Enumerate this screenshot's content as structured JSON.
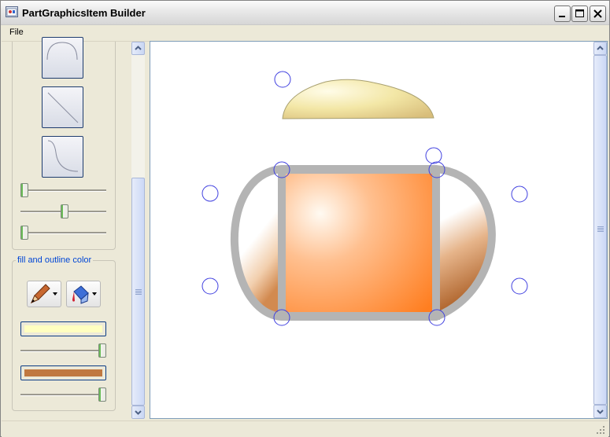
{
  "window": {
    "title": "PartGraphicsItem Builder"
  },
  "menu": {
    "file_label": "File"
  },
  "left_panel": {
    "group_fill_outline_label": "fill and outline color",
    "fill_swatch_color": "#ffffc0",
    "outline_swatch_color": "#c07840",
    "sliders": {
      "slider1": 0.0,
      "slider2": 0.5,
      "slider3": 0.0,
      "fill_alpha": 1.0,
      "outline_alpha": 1.0
    }
  },
  "colors": {
    "window_bg": "#ece9d8",
    "accent_blue": "#0046d5",
    "handle_stroke": "#4040e0",
    "shape_outline": "#b4b4b4",
    "orange_gradient_center": "#fff0e0",
    "orange_gradient_edge": "#ff8a30",
    "top_shape_fill": "#f0e0a0"
  },
  "icons": [
    "app-icon",
    "minimize-icon",
    "maximize-icon",
    "close-icon",
    "arc-shape-icon",
    "line-shape-icon",
    "curve-shape-icon",
    "pen-outline-icon",
    "paint-bucket-fill-icon",
    "scroll-up-icon",
    "scroll-down-icon",
    "resize-grip-icon"
  ]
}
